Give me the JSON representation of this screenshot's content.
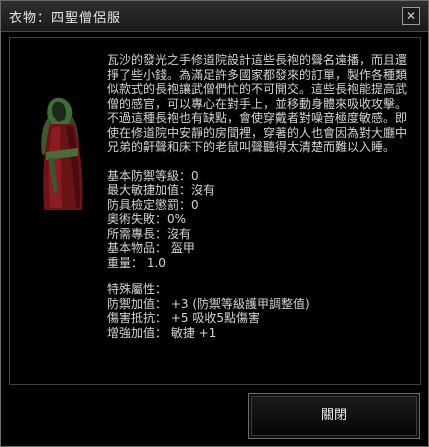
{
  "window": {
    "title": "衣物：四聖僧侶服",
    "close_icon": "close-icon"
  },
  "item": {
    "description": "瓦沙的發光之手修道院設計這些長袍的聲名遠播，而且還掙了些小錢。為滿足許多國家都發來的訂單，製作各種類似款式的長袍讓武僧們忙的不可開交。這些長袍能提高武僧的感官，可以專心在對手上，並移動身體來吸收攻擊。不過這種長袍也有缺點，會使穿戴者對噪音極度敏感。即使在修道院中安靜的房間裡，穿著的人也會因為對大廳中兄弟的鼾聲和床下的老鼠叫聲聽得太清楚而難以入睡。",
    "stats": [
      "基本防禦等級：0",
      "最大敏捷加值：沒有",
      "防具檢定懲罰：0",
      "奧術失敗：0%",
      "所需專長：沒有",
      "基本物品： 盔甲",
      "重量： 1.0"
    ],
    "special_header": "特殊屬性：",
    "special": [
      "防禦加值： +3 (防禦等級護甲調整值)",
      "傷害抵抗： +5 吸收5點傷害",
      "增強加值： 敏捷 +1"
    ],
    "portrait_icon": "robe-icon"
  },
  "footer": {
    "close_label": "關閉"
  }
}
